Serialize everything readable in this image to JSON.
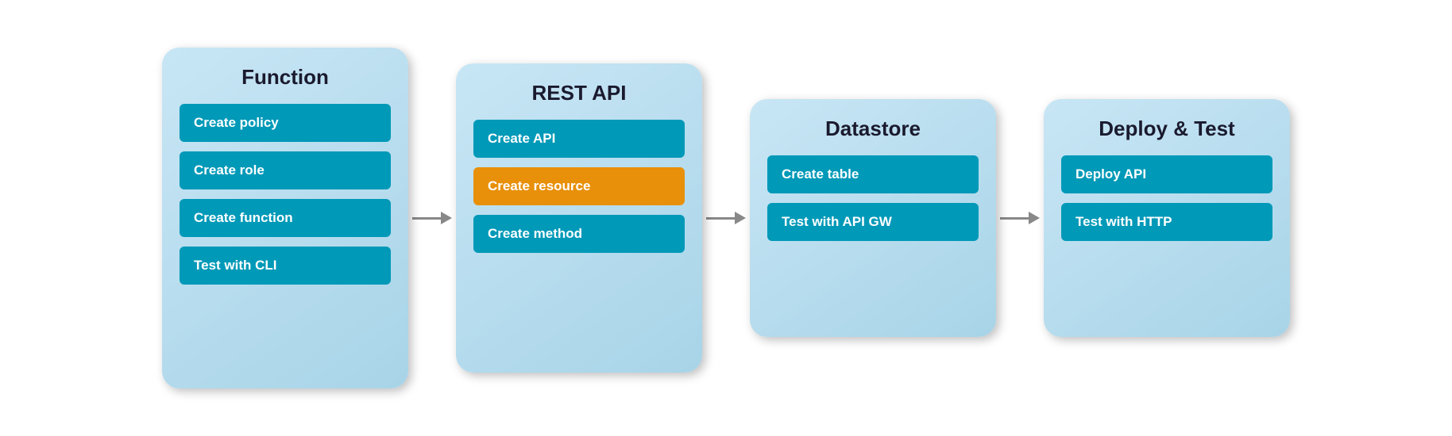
{
  "diagram": {
    "panels": [
      {
        "id": "function",
        "title": "Function",
        "buttons": [
          {
            "label": "Create policy",
            "style": "teal"
          },
          {
            "label": "Create role",
            "style": "teal"
          },
          {
            "label": "Create function",
            "style": "teal"
          },
          {
            "label": "Test with CLI",
            "style": "teal"
          }
        ]
      },
      {
        "id": "rest-api",
        "title": "REST API",
        "buttons": [
          {
            "label": "Create API",
            "style": "teal"
          },
          {
            "label": "Create resource",
            "style": "orange"
          },
          {
            "label": "Create method",
            "style": "teal"
          }
        ]
      },
      {
        "id": "datastore",
        "title": "Datastore",
        "buttons": [
          {
            "label": "Create table",
            "style": "teal"
          },
          {
            "label": "Test with API GW",
            "style": "teal"
          }
        ]
      },
      {
        "id": "deploy-test",
        "title": "Deploy & Test",
        "buttons": [
          {
            "label": "Deploy API",
            "style": "teal"
          },
          {
            "label": "Test with HTTP",
            "style": "teal"
          }
        ]
      }
    ],
    "arrow_label": "→"
  }
}
